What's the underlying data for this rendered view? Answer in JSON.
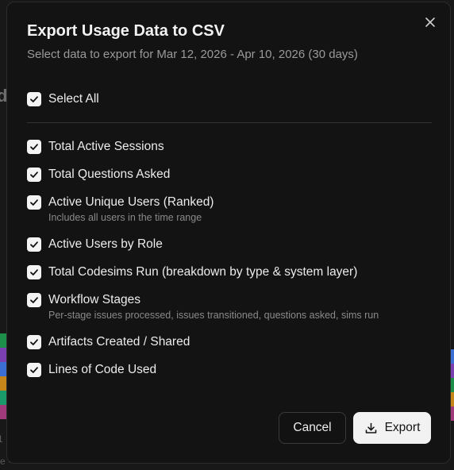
{
  "background": {
    "partial_letter": "d",
    "bottom_number": "1",
    "bottom_text": "e  ·  ·  ·  ·  ·  ·  ·  ·  ·  ·  ·  ·  ·  ·  ·  ·  ·  ·  ·  ·  ·  ·  ·  ·  ·",
    "strip_colors": [
      "#1e8f4a",
      "#7a3fb0",
      "#3b6fd4",
      "#c7861a",
      "#1a9a6a",
      "#a03a7a"
    ]
  },
  "dialog": {
    "title": "Export Usage Data to CSV",
    "subtitle": "Select data to export for Mar 12, 2026 - Apr 10, 2026 (30 days)",
    "close_icon": "close-icon",
    "select_all": {
      "label": "Select All",
      "checked": true
    },
    "options": [
      {
        "label": "Total Active Sessions",
        "checked": true
      },
      {
        "label": "Total Questions Asked",
        "checked": true
      },
      {
        "label": "Active Unique Users (Ranked)",
        "description": "Includes all users in the time range",
        "checked": true
      },
      {
        "label": "Active Users by Role",
        "checked": true
      },
      {
        "label": "Total Codesims Run (breakdown by type & system layer)",
        "checked": true
      },
      {
        "label": "Workflow Stages",
        "description": "Per-stage issues processed, issues transitioned, questions asked, sims run",
        "checked": true
      },
      {
        "label": "Artifacts Created / Shared",
        "checked": true
      },
      {
        "label": "Lines of Code Used",
        "checked": true
      }
    ],
    "cancel_label": "Cancel",
    "export_label": "Export",
    "export_icon": "download-icon"
  },
  "colors": {
    "modal_bg": "#131313",
    "checkbox_fill": "#f4f4f4",
    "primary_button": "#f2f2f2"
  }
}
